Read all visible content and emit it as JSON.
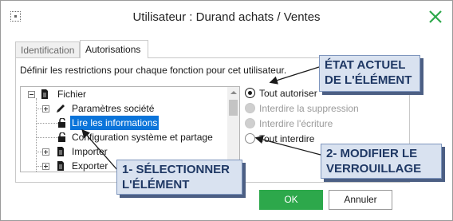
{
  "window": {
    "title": "Utilisateur : Durand achats / Ventes",
    "close_icon": "close-x-icon",
    "accent_color": "#2da84b"
  },
  "tabs": [
    {
      "label": "Identification",
      "active": false
    },
    {
      "label": "Autorisations",
      "active": true
    }
  ],
  "description": "Définir les restrictions pour chaque fonction pour cet utilisateur.",
  "tree": {
    "items": [
      {
        "label": "Fichier",
        "icon": "document-icon",
        "expander": "minus",
        "level": 0
      },
      {
        "label": "Paramètres société",
        "icon": "pencil-icon",
        "expander": "plus",
        "level": 1
      },
      {
        "label": "Lire les informations",
        "icon": "padlock-icon",
        "expander": "none",
        "level": 1,
        "selected": true
      },
      {
        "label": "Configuration système et partage",
        "icon": "padlock-icon",
        "expander": "none",
        "level": 1
      },
      {
        "label": "Importer",
        "icon": "document-icon",
        "expander": "plus",
        "level": 1
      },
      {
        "label": "Exporter",
        "icon": "document-icon",
        "expander": "plus",
        "level": 1
      }
    ]
  },
  "options": [
    {
      "label": "Tout autoriser",
      "checked": true,
      "disabled": false
    },
    {
      "label": "Interdire la suppression",
      "checked": false,
      "disabled": true
    },
    {
      "label": "Interdire l'écriture",
      "checked": false,
      "disabled": true
    },
    {
      "label": "Tout interdire",
      "checked": false,
      "disabled": false
    }
  ],
  "buttons": {
    "ok": "OK",
    "cancel": "Annuler"
  },
  "callouts": {
    "state": {
      "line1": "ÉTAT ACTUEL",
      "line2": "DE L'ÉLÉMENT"
    },
    "modify": {
      "line1": "2- MODIFIER LE",
      "line2": "VERROUILLAGE"
    },
    "select": {
      "line1": "1- SÉLECTIONNER",
      "line2": "L'ÉLÉMENT"
    },
    "color": "#1f3864"
  }
}
